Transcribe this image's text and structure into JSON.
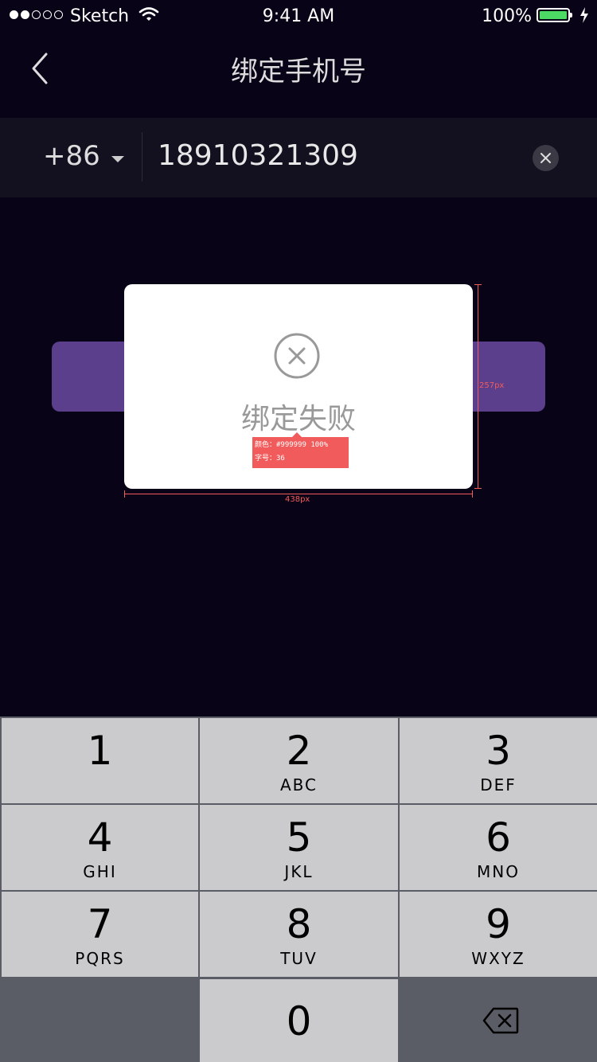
{
  "status_bar": {
    "carrier": "Sketch",
    "time": "9:41 AM",
    "battery_pct": "100%",
    "signal_icon": "signal-dots-icon",
    "wifi_icon": "wifi-icon",
    "battery_icon": "battery-icon",
    "charging_icon": "bolt-icon"
  },
  "nav": {
    "title": "绑定手机号",
    "back_icon": "chevron-left-icon"
  },
  "phone_form": {
    "country_code": "+86",
    "phone_value": "18910321309",
    "clear_icon": "close-circle-icon"
  },
  "dialog": {
    "message": "绑定失败",
    "icon": "close-circle-outline-icon"
  },
  "annotation": {
    "line1": "颜色：#999999 100%",
    "line2": "字号：36",
    "width_label": "438px",
    "height_label": "257px"
  },
  "keypad": {
    "keys": [
      {
        "num": "1",
        "letters": ""
      },
      {
        "num": "2",
        "letters": "ABC"
      },
      {
        "num": "3",
        "letters": "DEF"
      },
      {
        "num": "4",
        "letters": "GHI"
      },
      {
        "num": "5",
        "letters": "JKL"
      },
      {
        "num": "6",
        "letters": "MNO"
      },
      {
        "num": "7",
        "letters": "PQRS"
      },
      {
        "num": "8",
        "letters": "TUV"
      },
      {
        "num": "9",
        "letters": "WXYZ"
      },
      {
        "num": "0",
        "letters": ""
      }
    ],
    "backspace_icon": "backspace-icon"
  },
  "colors": {
    "background": "#080316",
    "accent": "#5b3f8d",
    "dialog_text": "#999999",
    "annotation": "#f25b5b"
  }
}
